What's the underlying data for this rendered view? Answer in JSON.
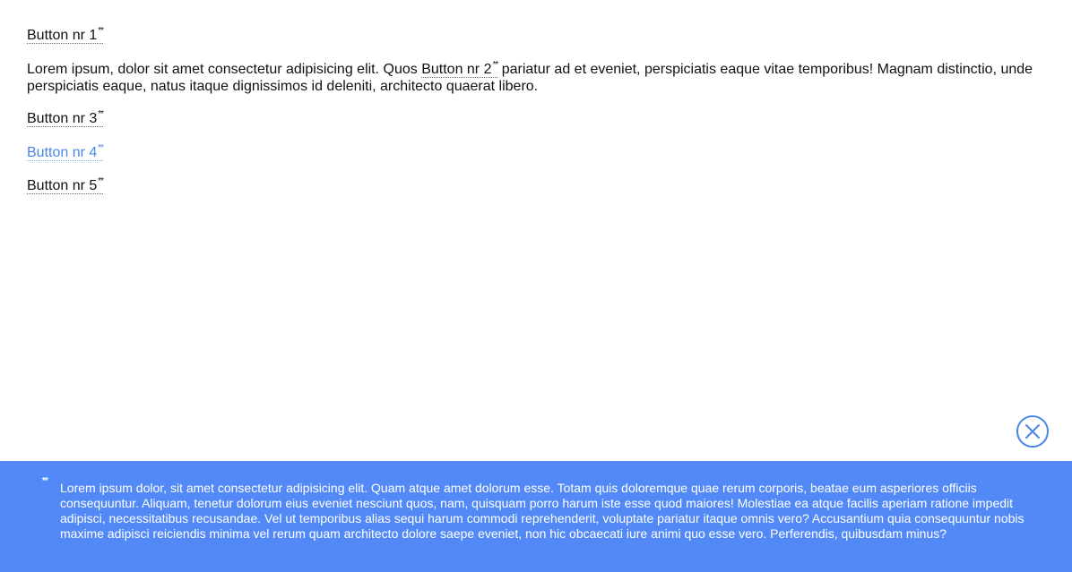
{
  "buttons": {
    "b1": {
      "label": "Button nr 1",
      "marker": "**"
    },
    "b2": {
      "label": "Button nr 2",
      "marker": "**"
    },
    "b3": {
      "label": "Button nr 3",
      "marker": "**"
    },
    "b4": {
      "label": "Button nr 4",
      "marker": "**"
    },
    "b5": {
      "label": "Button nr 5",
      "marker": "**"
    }
  },
  "paragraph": {
    "before": "Lorem ipsum, dolor sit amet consectetur adipisicing elit. Quos ",
    "after": " pariatur ad et eveniet, perspiciatis eaque vitae temporibus! Magnam distinctio, unde perspiciatis eaque, natus itaque dignissimos id deleniti, architecto quaerat libero."
  },
  "footnote": {
    "marker": "**",
    "text": "Lorem ipsum dolor, sit amet consectetur adipisicing elit. Quam atque amet dolorum esse. Totam quis doloremque quae rerum corporis, beatae eum asperiores officiis consequuntur. Aliquam, tenetur dolorum eius eveniet nesciunt quos, nam, quisquam porro harum iste esse quod maiores! Molestiae ea atque facilis aperiam ratione impedit adipisci, necessitatibus recusandae. Vel ut temporibus alias sequi harum commodi reprehenderit, voluptate pariatur itaque omnis vero? Accusantium quia consequuntur nobis maxime adipisci reiciendis minima vel rerum quam architecto dolore saepe eveniet, non hic obcaecati iure animi quo esse vero. Perferendis, quibusdam minus?",
    "close_icon": "close-circle-icon"
  },
  "colors": {
    "accent": "#4a86e8",
    "panel_background": "#5289f7",
    "panel_text": "#ffffff",
    "body_text": "#111111"
  },
  "state": {
    "active_button": "Button nr 4"
  }
}
